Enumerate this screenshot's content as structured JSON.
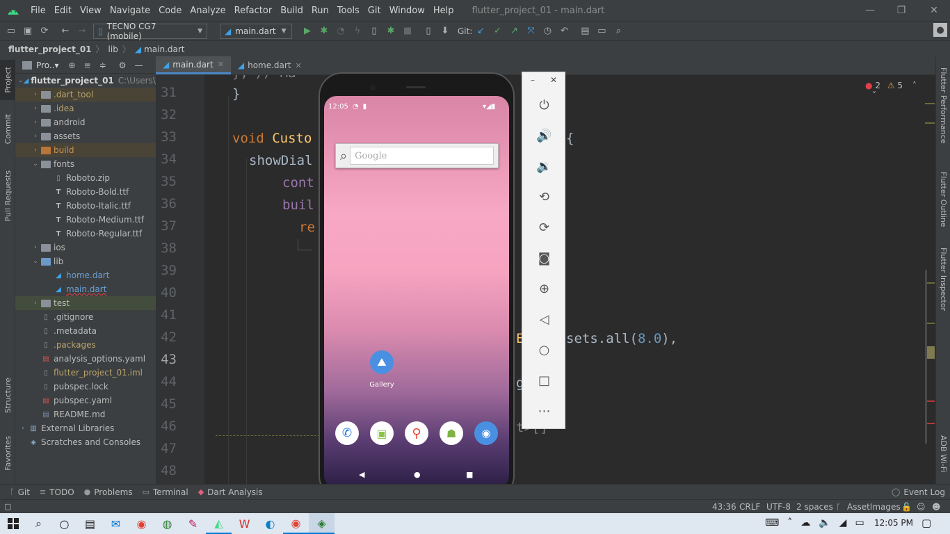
{
  "menubar": {
    "items": [
      "File",
      "Edit",
      "View",
      "Navigate",
      "Code",
      "Analyze",
      "Refactor",
      "Build",
      "Run",
      "Tools",
      "Git",
      "Window",
      "Help"
    ],
    "title": "flutter_project_01 - main.dart",
    "minimize": "—",
    "restore": "❐",
    "close": "✕"
  },
  "toolbar": {
    "device": "TECNO CG7 (mobile)",
    "config": "main.dart",
    "git_label": "Git:"
  },
  "breadcrumb": [
    "flutter_project_01",
    "lib",
    "main.dart"
  ],
  "project_panel": {
    "title": "Pro..▾",
    "root_name": "flutter_project_01",
    "root_path": "C:\\Users\\T",
    "items": [
      {
        "label": ".dart_tool",
        "depth": 1,
        "arrow": "›",
        "color": "#b9a36b"
      },
      {
        "label": ".idea",
        "depth": 1,
        "arrow": "›",
        "color": "#b9a36b"
      },
      {
        "label": "android",
        "depth": 1,
        "arrow": "›",
        "color": "#bbbbbb"
      },
      {
        "label": "assets",
        "depth": 1,
        "arrow": "›",
        "color": "#bbbbbb"
      },
      {
        "label": "build",
        "depth": 1,
        "arrow": "›",
        "color": "#c9914d"
      },
      {
        "label": "fonts",
        "depth": 1,
        "arrow": "⌄",
        "color": "#bbbbbb"
      },
      {
        "label": "Roboto.zip",
        "depth": 2,
        "arrow": "",
        "color": "#bbbbbb"
      },
      {
        "label": "Roboto-Bold.ttf",
        "depth": 2,
        "arrow": "",
        "color": "#bbbbbb"
      },
      {
        "label": "Roboto-Italic.ttf",
        "depth": 2,
        "arrow": "",
        "color": "#bbbbbb"
      },
      {
        "label": "Roboto-Medium.ttf",
        "depth": 2,
        "arrow": "",
        "color": "#bbbbbb"
      },
      {
        "label": "Roboto-Regular.ttf",
        "depth": 2,
        "arrow": "",
        "color": "#bbbbbb"
      },
      {
        "label": "ios",
        "depth": 1,
        "arrow": "›",
        "color": "#bbbbbb"
      },
      {
        "label": "lib",
        "depth": 1,
        "arrow": "⌄",
        "color": "#bbbbbb"
      },
      {
        "label": "home.dart",
        "depth": 2,
        "arrow": "",
        "color": "#6a9fd4"
      },
      {
        "label": "main.dart",
        "depth": 2,
        "arrow": "",
        "color": "#6a9fd4"
      },
      {
        "label": "test",
        "depth": 1,
        "arrow": "›",
        "color": "#bbbbbb"
      },
      {
        "label": ".gitignore",
        "depth": 1,
        "arrow": "",
        "color": "#bbbbbb"
      },
      {
        "label": ".metadata",
        "depth": 1,
        "arrow": "",
        "color": "#bbbbbb"
      },
      {
        "label": ".packages",
        "depth": 1,
        "arrow": "",
        "color": "#b9a36b"
      },
      {
        "label": "analysis_options.yaml",
        "depth": 1,
        "arrow": "",
        "color": "#bbbbbb"
      },
      {
        "label": "flutter_project_01.iml",
        "depth": 1,
        "arrow": "",
        "color": "#b9a36b"
      },
      {
        "label": "pubspec.lock",
        "depth": 1,
        "arrow": "",
        "color": "#bbbbbb"
      },
      {
        "label": "pubspec.yaml",
        "depth": 1,
        "arrow": "",
        "color": "#bbbbbb"
      },
      {
        "label": "README.md",
        "depth": 1,
        "arrow": "",
        "color": "#bbbbbb"
      },
      {
        "label": "External Libraries",
        "depth": 0,
        "arrow": "›",
        "color": "#bbbbbb"
      },
      {
        "label": "Scratches and Consoles",
        "depth": 0,
        "arrow": "",
        "color": "#bbbbbb"
      }
    ]
  },
  "editor": {
    "tabs": [
      {
        "label": "main.dart",
        "active": true
      },
      {
        "label": "home.dart",
        "active": false
      }
    ],
    "line_numbers": [
      "31",
      "32",
      "33",
      "34",
      "35",
      "36",
      "37",
      "38",
      "39",
      "40",
      "41",
      "42",
      "43",
      "44",
      "45",
      "46",
      "47",
      "48"
    ],
    "current_line": "43",
    "errors": "2",
    "warnings": "5",
    "partial_top": "}, // Ma",
    "lines": {
      "l31": "}",
      "l33a": "void ",
      "l33b": "Custo",
      "l33c": "{",
      "l34": "showDial",
      "l35": "cont",
      "l36": "buil",
      "l37": "re",
      "l42a": "E",
      "l42b": "sets.all(",
      "l42c": "8.0",
      "l42d": "),",
      "l44": "g",
      "l46": "t>[]"
    }
  },
  "emulator": {
    "time": "12:05",
    "search_placeholder": "Google",
    "gallery_label": "Gallery"
  },
  "bottom_tools": [
    "Git",
    "TODO",
    "Problems",
    "Terminal",
    "Dart Analysis"
  ],
  "event_log": "Event Log",
  "status": {
    "position": "43:36",
    "line_sep": "CRLF",
    "encoding": "UTF-8",
    "indent": "2 spaces",
    "vcs": "AssetImages"
  },
  "right_tabs": [
    "Flutter Performance",
    "Flutter Outline",
    "Flutter Inspector",
    "ADB Wi-Fi"
  ],
  "left_tabs": [
    "Project",
    "Commit",
    "Pull Requests",
    "Structure",
    "Favorites"
  ],
  "taskbar": {
    "time": "12:05 PM"
  }
}
